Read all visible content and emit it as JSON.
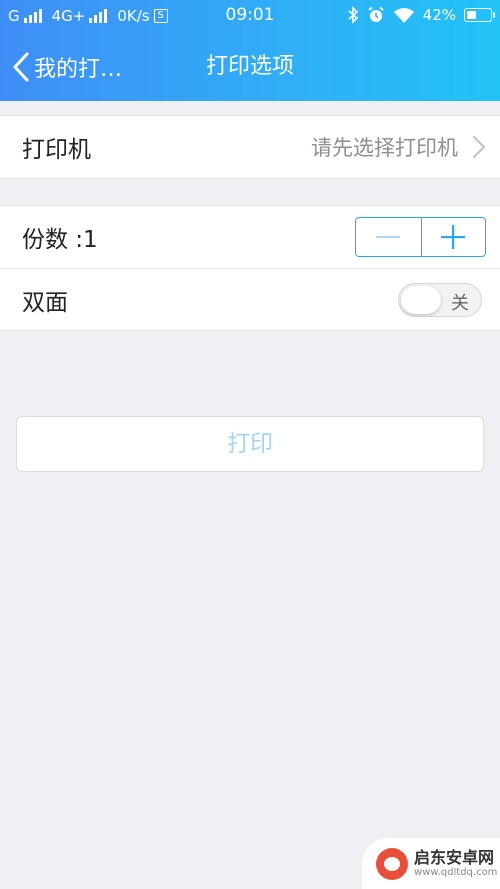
{
  "status_bar": {
    "carrier1": "G",
    "carrier2": "4G+",
    "speed": "0K/s",
    "sim_badge": "S",
    "time": "09:01",
    "battery": "42%",
    "battery_level": 0.42
  },
  "nav": {
    "back_label": "我的打…",
    "title": "打印选项"
  },
  "printer_row": {
    "label": "打印机",
    "value": "请先选择打印机"
  },
  "copies_row": {
    "label": "份数 :1"
  },
  "duplex_row": {
    "label": "双面",
    "toggle_text": "关",
    "enabled": false
  },
  "print_button": {
    "label": "打印"
  },
  "watermark": {
    "name": "启东安卓网",
    "url": "www.qdltdq.com"
  },
  "colors": {
    "accent": "#2aa7e8",
    "header_start": "#3f8ef7",
    "header_end": "#21c3f7",
    "disabled_text": "#a5d6ee"
  }
}
